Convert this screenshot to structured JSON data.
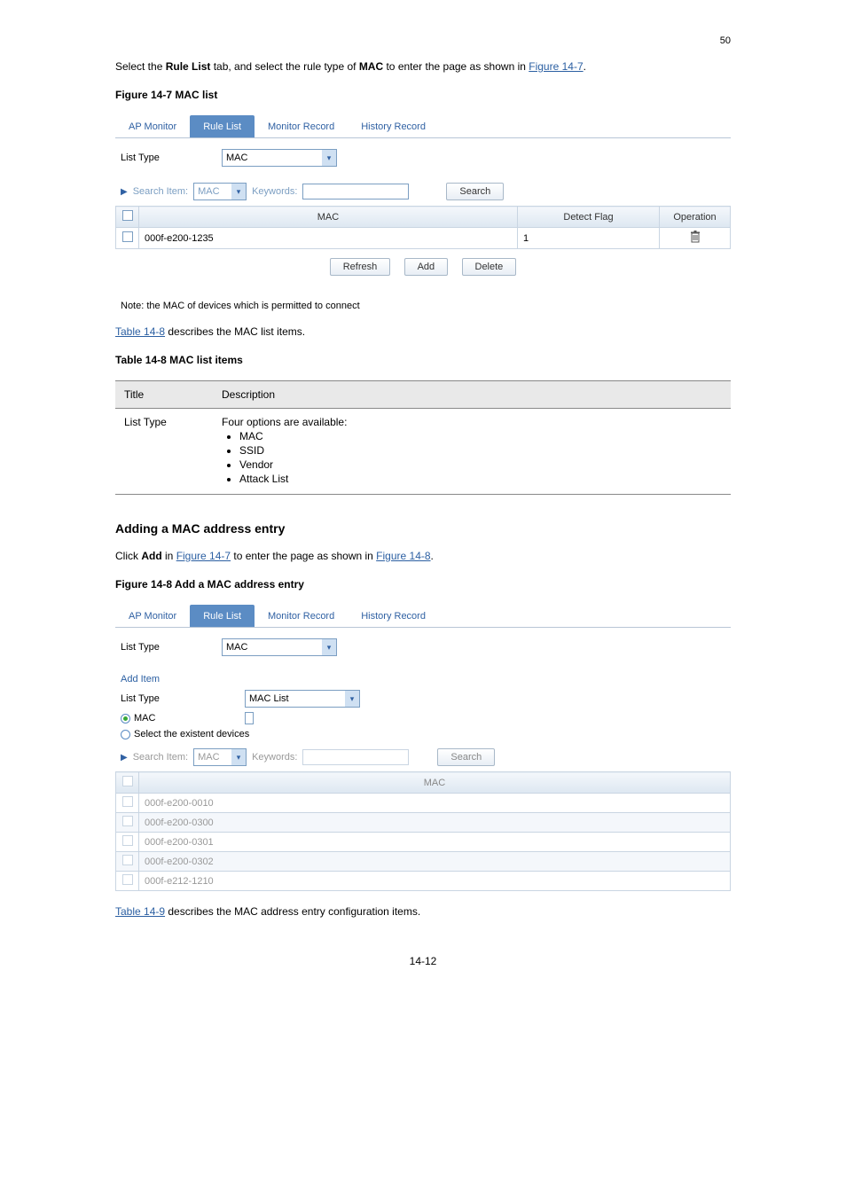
{
  "rtl": "50",
  "intro_prefix": "Select the ",
  "intro_bold1": "Rule List",
  "intro_mid": " tab, and select the rule type of ",
  "intro_bold2": "MAC",
  "intro_suffix": " to enter the page as shown in ",
  "intro_link": "Figure 14-7",
  "intro_end": ".",
  "fig1_caption": "Figure 14-7 MAC list",
  "tabs": {
    "ap": "AP Monitor",
    "rule": "Rule List",
    "mon": "Monitor Record",
    "hist": "History Record"
  },
  "shot1": {
    "list_type_lbl": "List Type",
    "list_type_val": "MAC",
    "search_item": "Search Item:",
    "search_item_val": "MAC",
    "keywords": "Keywords:",
    "search_btn": "Search",
    "th_mac": "MAC",
    "th_detect": "Detect Flag",
    "th_op": "Operation",
    "row_mac": "000f-e200-1235",
    "row_detect": "1",
    "refresh": "Refresh",
    "add": "Add",
    "delete": "Delete",
    "note": "Note: the MAC of devices which is permitted to connect"
  },
  "table14_8": {
    "link": "Table 14-8",
    "suffix": " describes the MAC list items.",
    "caption": "Table 14-8 MAC list items",
    "th_title": "Title",
    "th_desc": "Description",
    "t1": "List Type",
    "d1_intro": "Four options are available:",
    "d1_items": [
      "MAC",
      "SSID",
      "Vendor",
      "Attack List"
    ]
  },
  "adding": {
    "heading": "Adding a MAC address entry",
    "para_prefix": "Click ",
    "para_bold": "Add",
    "para_mid": " in ",
    "fig_link1": "Figure 14-7",
    "para_mid2": " to enter the page as shown in ",
    "fig_link2": "Figure 14-8",
    "para_end": ".",
    "caption": "Figure 14-8 Add a MAC address entry"
  },
  "shot2": {
    "list_type_lbl": "List Type",
    "list_type_val": "MAC",
    "add_item": "Add Item",
    "lt_lbl": "List Type",
    "lt_val": "MAC List",
    "mac_radio": "MAC",
    "sel_radio": "Select the existent devices",
    "search_item": "Search Item:",
    "search_item_val": "MAC",
    "keywords": "Keywords:",
    "search_btn": "Search",
    "th_mac": "MAC",
    "rows": [
      "000f-e200-0010",
      "000f-e200-0300",
      "000f-e200-0301",
      "000f-e200-0302",
      "000f-e212-1210"
    ]
  },
  "table14_9": {
    "link": "Table 14-9",
    "suffix": " describes the MAC address entry configuration items."
  },
  "page_num": "14-12"
}
